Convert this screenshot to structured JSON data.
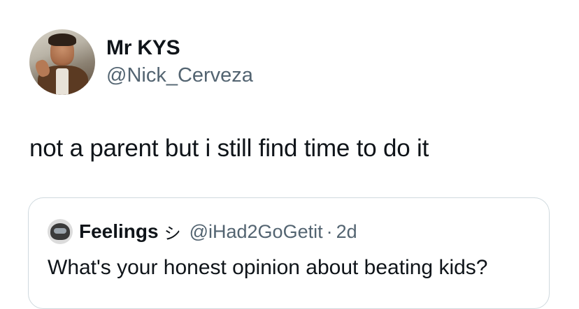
{
  "author": {
    "display_name": "Mr KYS",
    "handle": "@Nick_Cerveza",
    "avatar_icon": "profile-photo"
  },
  "tweet": {
    "text": "not a parent but i still find time to do it"
  },
  "quoted_tweet": {
    "display_name": "Feelings",
    "name_emoji": "シ",
    "handle": "@iHad2GoGetit",
    "separator": "·",
    "time": "2d",
    "text": "What's your honest opinion about beating kids?",
    "avatar_icon": "helmet-avatar"
  },
  "colors": {
    "text": "#0f1419",
    "secondary": "#536471",
    "border": "#cfd9de"
  }
}
